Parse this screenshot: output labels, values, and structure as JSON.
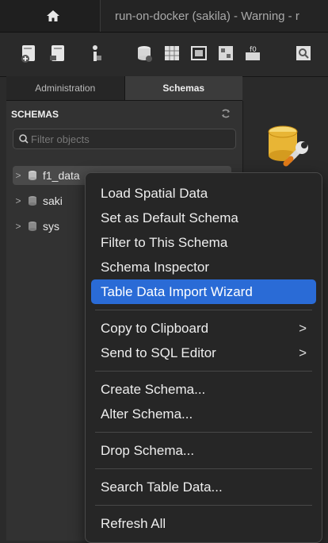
{
  "titlebar": {
    "home_icon": "home-icon",
    "connection_title": "run-on-docker (sakila) - Warning - r"
  },
  "toolbar": {
    "icons": [
      "new-sql-tab-icon",
      "open-sql-script-icon",
      "inspector-icon",
      "create-schema-icon",
      "create-table-icon",
      "create-view-icon",
      "create-procedure-icon",
      "create-function-icon",
      "search-table-data-icon"
    ]
  },
  "sidebar": {
    "tabs": [
      {
        "label": "Administration"
      },
      {
        "label": "Schemas"
      }
    ],
    "header": "SCHEMAS",
    "filter_placeholder": "Filter objects",
    "schemas": [
      {
        "name": "f1_data"
      },
      {
        "name": "saki"
      },
      {
        "name": "sys"
      }
    ]
  },
  "context_menu": {
    "group1": [
      {
        "label": "Load Spatial Data"
      },
      {
        "label": "Set as Default Schema"
      },
      {
        "label": "Filter to This Schema"
      },
      {
        "label": "Schema Inspector"
      },
      {
        "label": "Table Data Import Wizard",
        "highlighted": true
      }
    ],
    "group2": [
      {
        "label": "Copy to Clipboard",
        "submenu": true
      },
      {
        "label": "Send to SQL Editor",
        "submenu": true
      }
    ],
    "group3": [
      {
        "label": "Create Schema..."
      },
      {
        "label": "Alter Schema..."
      }
    ],
    "group4": [
      {
        "label": "Drop Schema..."
      }
    ],
    "group5": [
      {
        "label": "Search Table Data..."
      }
    ],
    "group6": [
      {
        "label": "Refresh All"
      }
    ],
    "arrow_glyph": ">"
  },
  "colors": {
    "highlight": "#2a6bd6",
    "menu_bg": "#262626",
    "sidebar_bg": "#323232"
  }
}
